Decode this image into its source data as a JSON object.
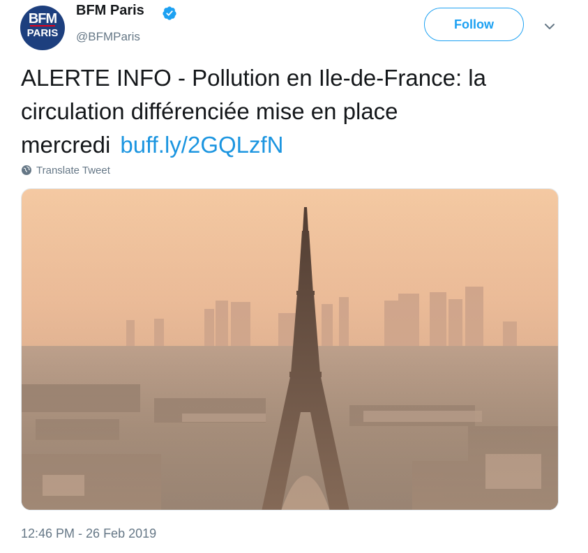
{
  "author": {
    "display_name": "BFM Paris",
    "handle": "@BFMParis",
    "avatar_text_top": "BFM",
    "avatar_text_bottom": "PARIS",
    "verified": true
  },
  "actions": {
    "follow_label": "Follow",
    "menu_icon": "chevron-down-icon"
  },
  "tweet": {
    "text": "ALERTE INFO - Pollution en Ile-de-France: la circulation différenciée mise en place mercredi",
    "link": "buff.ly/2GQLzfN",
    "translate_label": "Translate Tweet",
    "timestamp": "12:46 PM - 26 Feb 2019"
  },
  "media": {
    "icon": "photo-eiffel-tower-smog"
  },
  "colors": {
    "accent": "#1da1f2",
    "link": "#1b95e0",
    "muted": "#657786",
    "text": "#14171a"
  }
}
